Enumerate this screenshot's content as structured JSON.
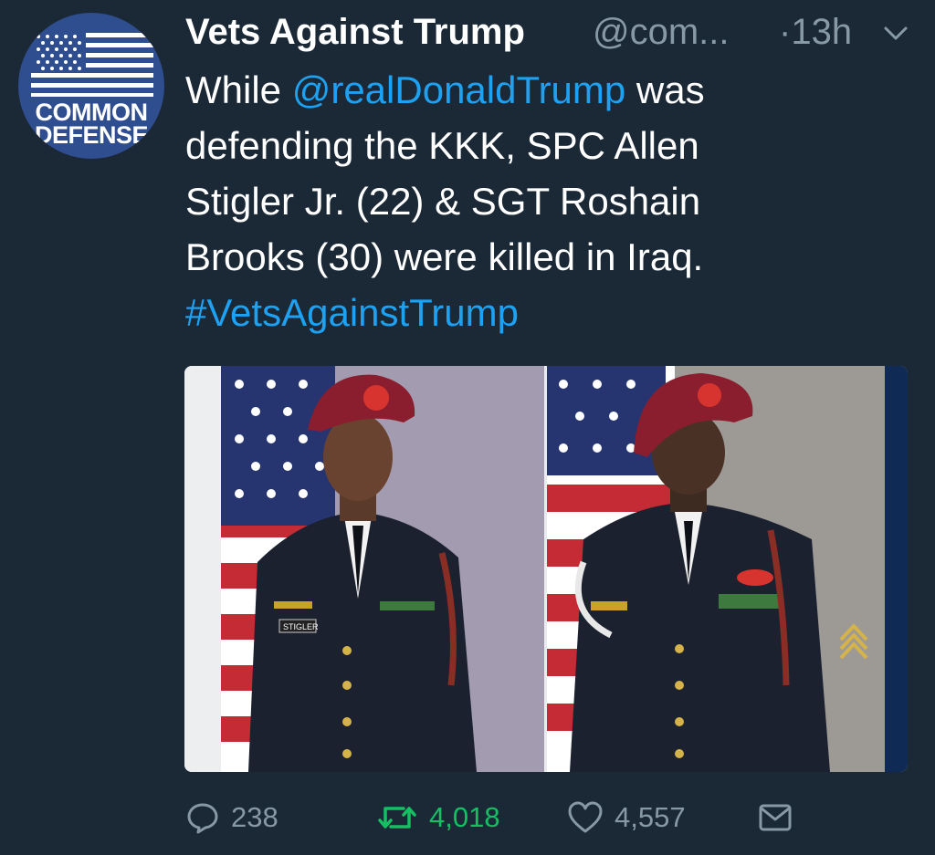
{
  "account": {
    "avatar_text_line1": "COMMON",
    "avatar_text_line2": "DEFENSE",
    "display_name": "Vets Against Trump",
    "handle": "@com...",
    "timestamp": "·13h"
  },
  "tweet": {
    "lines": [
      {
        "pre": "While ",
        "link": "@realDonaldTrump",
        "post": " was"
      },
      {
        "text": "defending the KKK, SPC Allen"
      },
      {
        "text": "Stigler Jr. (22) & SGT Roshain"
      },
      {
        "text": "Brooks (30) were killed in Iraq."
      },
      {
        "link": "#VetsAgainstTrump"
      }
    ]
  },
  "media": {
    "photos": [
      {
        "subject": "soldier-portrait-stigler",
        "nametag": "STIGLER"
      },
      {
        "subject": "soldier-portrait-brooks"
      }
    ]
  },
  "actions": {
    "replies": "238",
    "retweets": "4,018",
    "likes": "4,557"
  },
  "colors": {
    "background": "#1b2836",
    "link": "#1da1f2",
    "muted": "#8899a6",
    "retweet": "#17bf63",
    "avatar_bg": "#2f4e8f"
  },
  "icons": [
    "chevron-down-icon",
    "reply-icon",
    "retweet-icon",
    "like-icon",
    "direct-message-icon"
  ]
}
